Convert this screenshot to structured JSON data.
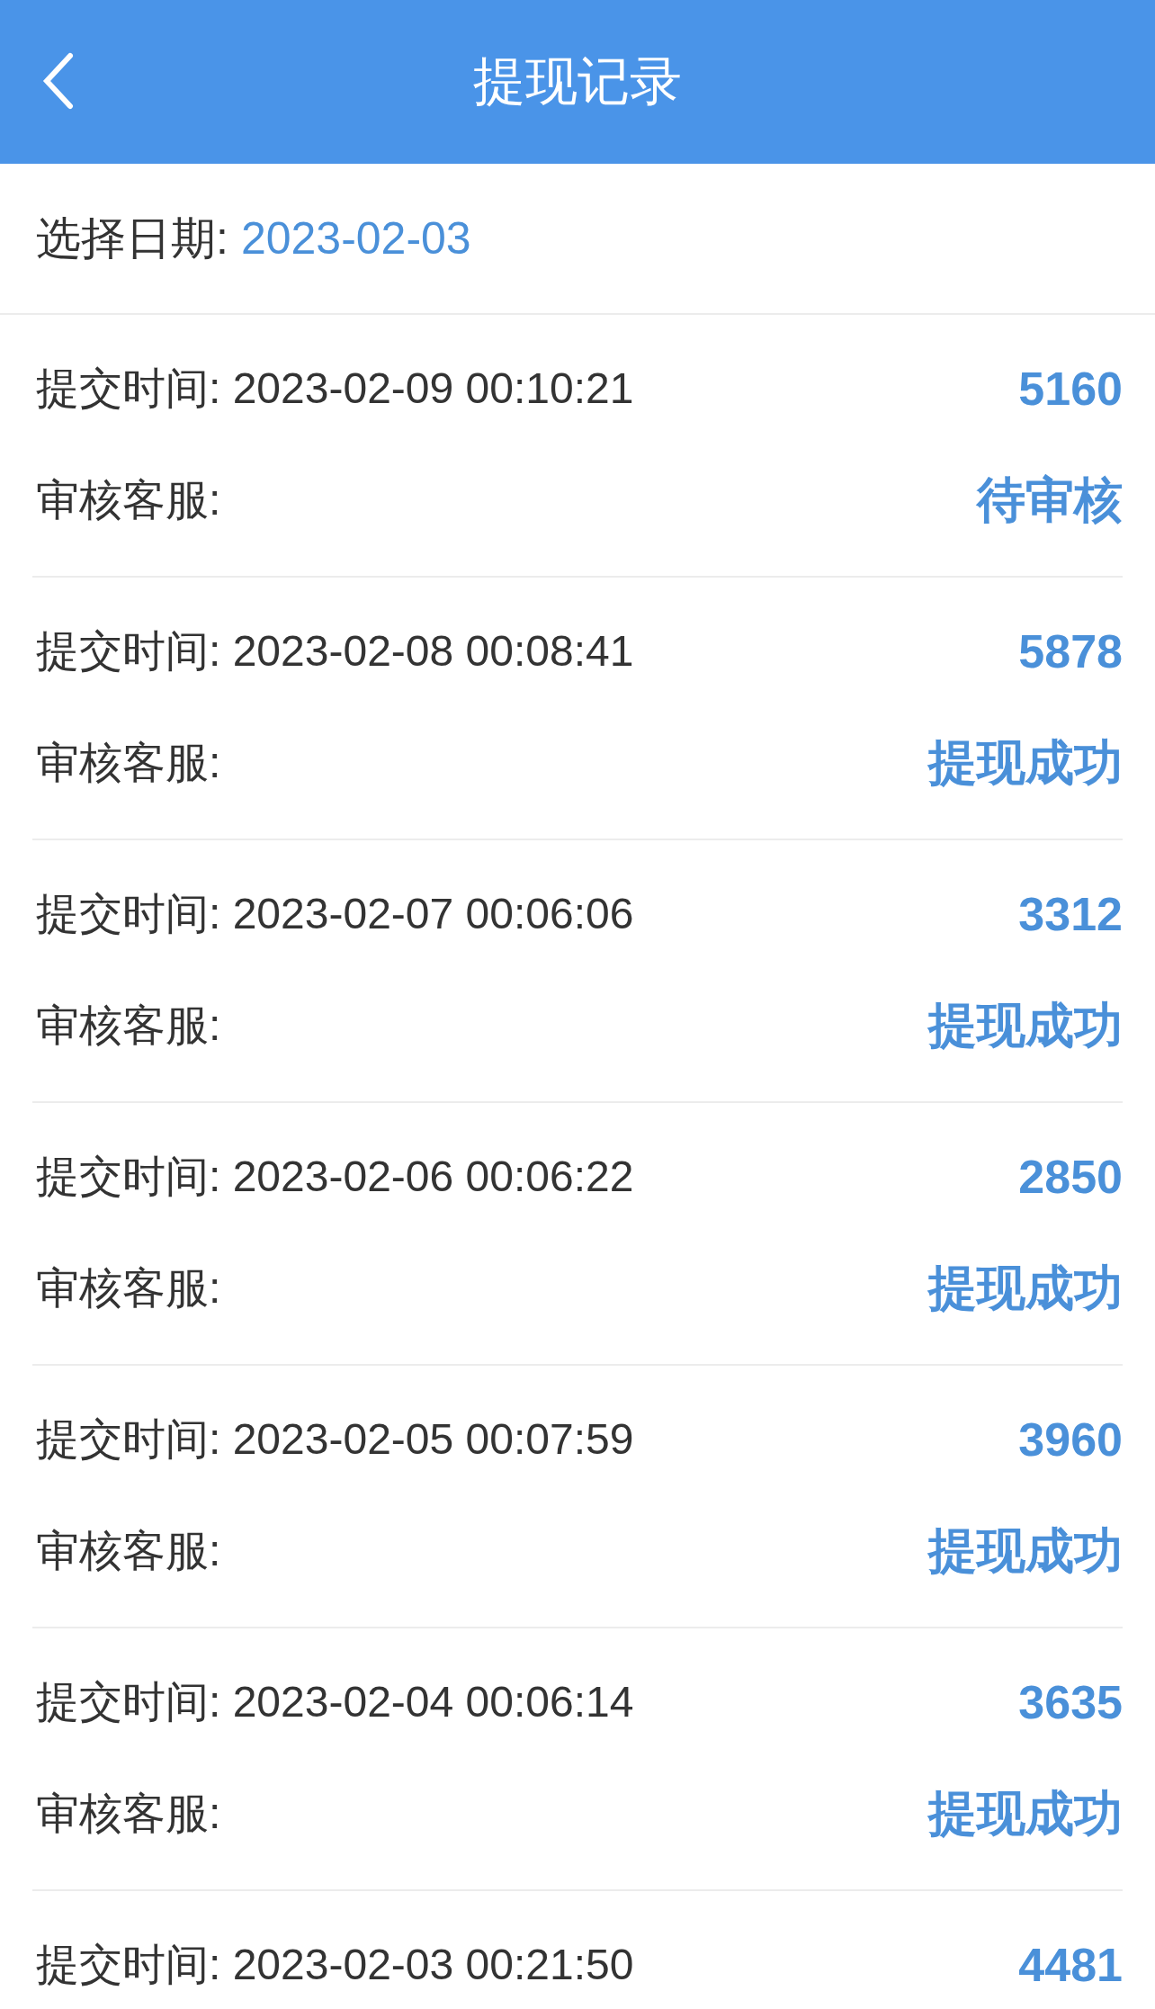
{
  "header": {
    "title": "提现记录"
  },
  "date_filter": {
    "label": "选择日期:",
    "value": "2023-02-03"
  },
  "records": [
    {
      "time_label": "提交时间:",
      "time": "2023-02-09 00:10:21",
      "amount": "5160",
      "reviewer_label": "审核客服:",
      "status": "待审核"
    },
    {
      "time_label": "提交时间:",
      "time": "2023-02-08 00:08:41",
      "amount": "5878",
      "reviewer_label": "审核客服:",
      "status": "提现成功"
    },
    {
      "time_label": "提交时间:",
      "time": "2023-02-07 00:06:06",
      "amount": "3312",
      "reviewer_label": "审核客服:",
      "status": "提现成功"
    },
    {
      "time_label": "提交时间:",
      "time": "2023-02-06 00:06:22",
      "amount": "2850",
      "reviewer_label": "审核客服:",
      "status": "提现成功"
    },
    {
      "time_label": "提交时间:",
      "time": "2023-02-05 00:07:59",
      "amount": "3960",
      "reviewer_label": "审核客服:",
      "status": "提现成功"
    },
    {
      "time_label": "提交时间:",
      "time": "2023-02-04 00:06:14",
      "amount": "3635",
      "reviewer_label": "审核客服:",
      "status": "提现成功"
    },
    {
      "time_label": "提交时间:",
      "time": "2023-02-03 00:21:50",
      "amount": "4481"
    }
  ]
}
